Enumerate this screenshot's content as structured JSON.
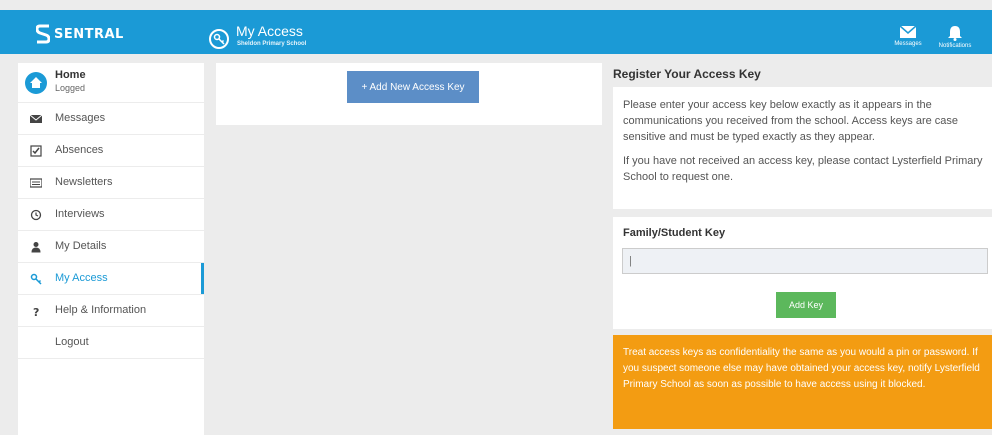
{
  "brand": {
    "name": "SENTRAL"
  },
  "header": {
    "title": "My Access",
    "school": "Sheldon Primary School",
    "actions": [
      {
        "label": "Messages",
        "icon": "envelope-icon"
      },
      {
        "label": "Notifications",
        "icon": "bell-icon"
      }
    ]
  },
  "sidebar": {
    "home": {
      "title": "Home",
      "subtitle": "Logged"
    },
    "items": [
      {
        "label": "Messages",
        "icon": "envelope-icon"
      },
      {
        "label": "Absences",
        "icon": "checklist-icon"
      },
      {
        "label": "Newsletters",
        "icon": "newspaper-icon"
      },
      {
        "label": "Interviews",
        "icon": "clock-icon"
      },
      {
        "label": "My Details",
        "icon": "user-icon"
      },
      {
        "label": "My Access",
        "icon": "key-icon",
        "active": true
      },
      {
        "label": "Help & Information",
        "icon": "question-icon"
      },
      {
        "label": "Logout",
        "icon": ""
      }
    ]
  },
  "main": {
    "add_button": "+ Add New Access Key"
  },
  "register": {
    "title": "Register Your Access Key",
    "info_1": "Please enter your access key below exactly as it appears in the communications you received from the school. Access keys are case sensitive and must be typed exactly as they appear.",
    "info_2": "If you have not received an access key, please contact Lysterfield Primary School to request one.",
    "field_label": "Family/Student Key",
    "field_value": "",
    "field_placeholder": "|",
    "submit": "Add Key",
    "warning": "Treat access keys as confidentiality the same as you would a pin or password. If you suspect someone else may have obtained your access key, notify Lysterfield Primary School as soon as possible to have access using it blocked."
  },
  "colors": {
    "primary": "#1b9ad6",
    "success": "#5cb85c",
    "warning": "#f39c12",
    "button": "#5c8ec7"
  }
}
